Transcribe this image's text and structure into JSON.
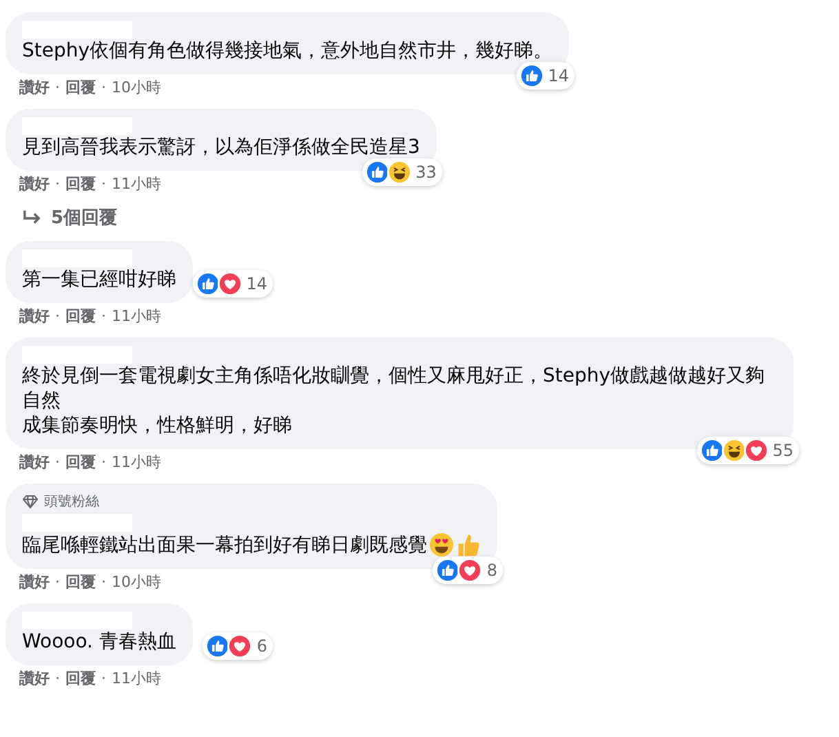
{
  "comments": [
    {
      "lines": [
        "Stephy依個有角色做得幾接地氣，意外地自然市井，幾好睇。"
      ],
      "reactions": [
        {
          "kind": "like"
        }
      ],
      "reaction_count": "14",
      "meta": [
        {
          "kind": "link",
          "text": "讚好"
        },
        {
          "kind": "separator",
          "text": "·"
        },
        {
          "kind": "link",
          "text": "回覆"
        },
        {
          "kind": "separator",
          "text": "·"
        },
        {
          "kind": "time",
          "text": "10小時"
        }
      ]
    },
    {
      "lines": [
        "見到高晉我表示驚訝，以為佢淨係做全民造星3"
      ],
      "reactions": [
        {
          "kind": "like"
        },
        {
          "kind": "haha"
        }
      ],
      "reaction_count": "33",
      "meta": [
        {
          "kind": "link",
          "text": "讚好"
        },
        {
          "kind": "separator",
          "text": "·"
        },
        {
          "kind": "link",
          "text": "回覆"
        },
        {
          "kind": "separator",
          "text": "·"
        },
        {
          "kind": "time",
          "text": "11小時"
        }
      ],
      "replies_link": "5個回覆"
    },
    {
      "lines": [
        "第一集已經咁好睇"
      ],
      "reactions": [
        {
          "kind": "like"
        },
        {
          "kind": "love"
        }
      ],
      "reaction_count": "14",
      "meta": [
        {
          "kind": "link",
          "text": "讚好"
        },
        {
          "kind": "separator",
          "text": "·"
        },
        {
          "kind": "link",
          "text": "回覆"
        },
        {
          "kind": "separator",
          "text": "·"
        },
        {
          "kind": "time",
          "text": "11小時"
        }
      ]
    },
    {
      "lines": [
        "終於見倒一套電視劇女主角係唔化妝瞓覺，個性又麻甩好正，Stephy做戲越做越好又夠自然",
        "成集節奏明快，性格鮮明，好睇"
      ],
      "reactions": [
        {
          "kind": "like"
        },
        {
          "kind": "haha"
        },
        {
          "kind": "love"
        }
      ],
      "reaction_count": "55",
      "meta": [
        {
          "kind": "link",
          "text": "讚好"
        },
        {
          "kind": "separator",
          "text": "·"
        },
        {
          "kind": "link",
          "text": "回覆"
        },
        {
          "kind": "separator",
          "text": "·"
        },
        {
          "kind": "time",
          "text": "11小時"
        }
      ]
    },
    {
      "badge": "頭號粉絲",
      "lines": [
        "臨尾喺輕鐵站出面果一幕拍到好有睇日劇既感覺"
      ],
      "emojis": [
        {
          "kind": "heart-eyes"
        },
        {
          "kind": "thumbs-up"
        }
      ],
      "reactions": [
        {
          "kind": "like"
        },
        {
          "kind": "love"
        }
      ],
      "reaction_count": "8",
      "meta": [
        {
          "kind": "link",
          "text": "讚好"
        },
        {
          "kind": "separator",
          "text": "·"
        },
        {
          "kind": "link",
          "text": "回覆"
        },
        {
          "kind": "separator",
          "text": "·"
        },
        {
          "kind": "time",
          "text": "10小時"
        }
      ]
    },
    {
      "lines": [
        "Woooo. 青春熱血"
      ],
      "reactions": [
        {
          "kind": "like"
        },
        {
          "kind": "love"
        }
      ],
      "reaction_count": "6",
      "meta": [
        {
          "kind": "link",
          "text": "讚好"
        },
        {
          "kind": "separator",
          "text": "·"
        },
        {
          "kind": "link",
          "text": "回覆"
        },
        {
          "kind": "separator",
          "text": "·"
        },
        {
          "kind": "time",
          "text": "11小時"
        }
      ]
    }
  ]
}
